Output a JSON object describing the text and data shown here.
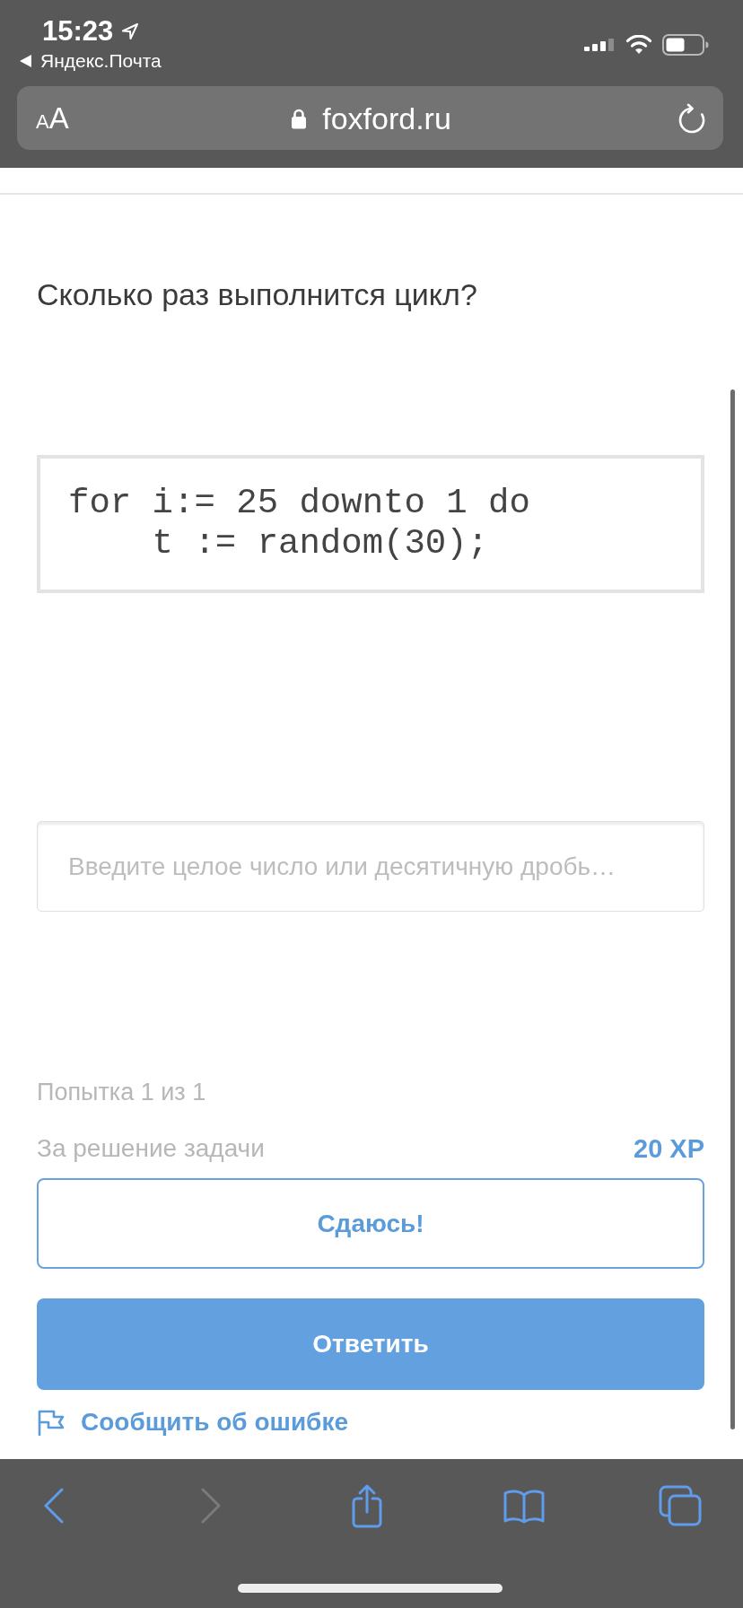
{
  "status_bar": {
    "time": "15:23",
    "back_app": "Яндекс.Почта"
  },
  "address_bar": {
    "text_size": {
      "small": "A",
      "large": "A"
    },
    "url": "foxford.ru"
  },
  "task": {
    "question": "Сколько раз выполнится цикл?",
    "code_lines": [
      "for i:= 25 downto 1 do",
      "    t := random(30);"
    ],
    "answer_field": {
      "placeholder": "Введите целое число или десятичную дробь…"
    },
    "attempt": "Попытка 1 из 1",
    "reward": {
      "label": "За решение задачи",
      "value": "20 XP"
    },
    "buttons": [
      {
        "label": "Сдаюсь!",
        "kind": "outline"
      },
      {
        "label": "Ответить",
        "kind": "primary"
      }
    ],
    "report_link": "Сообщить об ошибке"
  },
  "toolbar": [
    {
      "kind": "back",
      "disabled": false
    },
    {
      "kind": "forward",
      "disabled": true
    },
    {
      "kind": "share",
      "disabled": false
    },
    {
      "kind": "bookmarks",
      "disabled": false
    },
    {
      "kind": "tabs",
      "disabled": false
    }
  ]
}
